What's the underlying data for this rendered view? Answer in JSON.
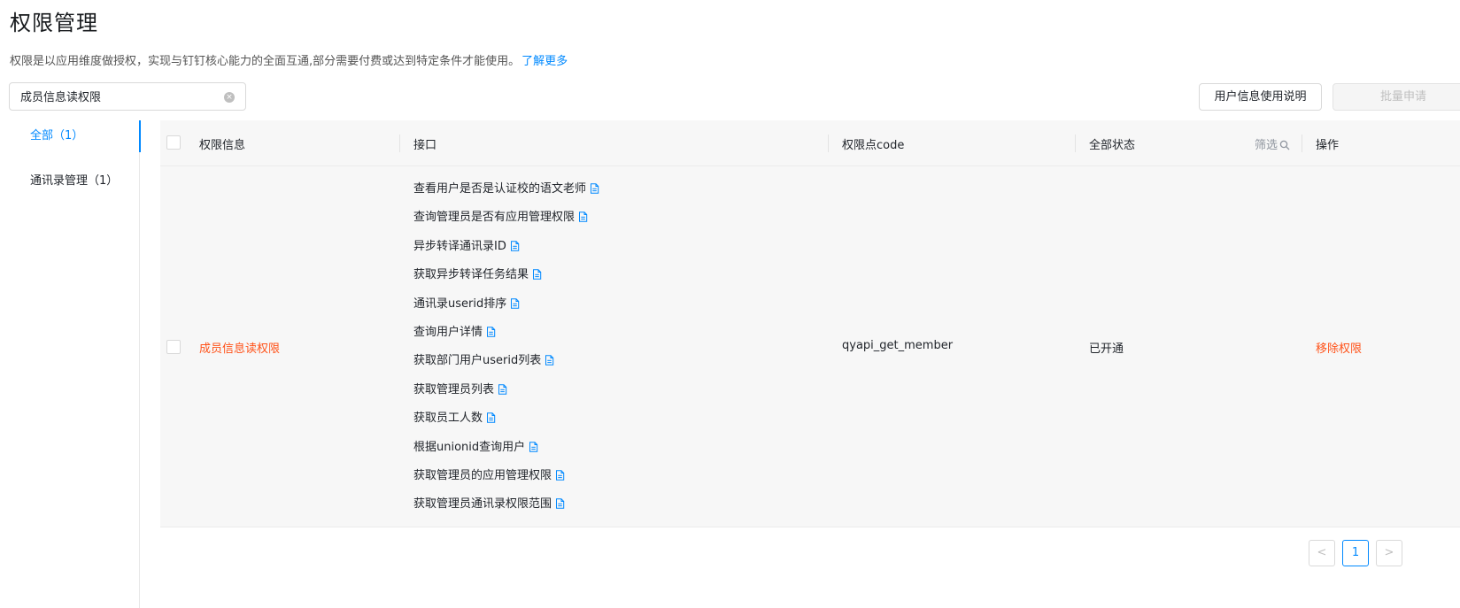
{
  "page": {
    "title": "权限管理",
    "description": "权限是以应用维度做授权，实现与钉钉核心能力的全面互通,部分需要付费或达到特定条件才能使用。",
    "learn_more": "了解更多"
  },
  "search": {
    "value": "成员信息读权限",
    "clear_icon": "clear-circle-icon"
  },
  "toolbar": {
    "user_info_button": "用户信息使用说明",
    "batch_button": "批量申请"
  },
  "nav": {
    "items": [
      {
        "label": "全部（1）",
        "active": true
      },
      {
        "label": "通讯录管理（1）",
        "active": false
      }
    ]
  },
  "table": {
    "headers": {
      "perm_info": "权限信息",
      "interface": "接口",
      "code": "权限点code",
      "status": "全部状态",
      "filter": "筛选",
      "action": "操作"
    },
    "rows": [
      {
        "perm_name": "成员信息读权限",
        "apis": [
          "查看用户是否是认证校的语文老师",
          "查询管理员是否有应用管理权限",
          "异步转译通讯录ID",
          "获取异步转译任务结果",
          "通讯录userid排序",
          "查询用户详情",
          "获取部门用户userid列表",
          "获取管理员列表",
          "获取员工人数",
          "根据unionid查询用户",
          "获取管理员的应用管理权限",
          "获取管理员通讯录权限范围"
        ],
        "code": "qyapi_get_member",
        "status": "已开通",
        "action": "移除权限"
      }
    ]
  },
  "pagination": {
    "prev": "<",
    "current": "1",
    "next": ">"
  },
  "colors": {
    "accent": "#0089ff",
    "danger": "#ff5219",
    "row_bg": "#f7f7f7"
  }
}
